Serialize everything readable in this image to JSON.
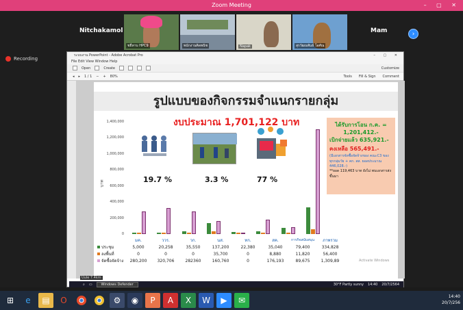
{
  "zoom": {
    "window_title": "Zoom Meeting",
    "recording_label": "Recording",
    "participants": [
      {
        "name": "Nitchakamol"
      },
      {
        "name": "Mam"
      }
    ],
    "tile_labels": [
      "ชยี่หาบ HPC9",
      "พนักงานคิดพนิช",
      "Napak",
      "สุรวัฒนพันธ์ โอศัณ"
    ]
  },
  "acrobat": {
    "title": "ระบบงาน PowerPoint - Adobe Acrobat Pro",
    "menu": "File  Edit  View  Window  Help",
    "toolbar_open": "Open",
    "toolbar_create": "Create",
    "customize": "Customize",
    "page_info": "1 / 1",
    "zoom": "80%",
    "tools": "Tools",
    "fill_sign": "Fill & Sign",
    "comment": "Comment"
  },
  "slide": {
    "title": "รูปแบบของกิจกรรมจำแนกรายกลุ่ม",
    "budget": "งบประมาณ  1,701,122  บาท",
    "y_axis_label": "บาท",
    "pct_1": "19.7 %",
    "pct_2": "3.3 %",
    "pct_3": "77 %",
    "info_line1": "ได้รับการโอน ก.ค. =",
    "info_line2": "1,201,412.-",
    "info_line3": "เบิกจ่ายแล้ว 635,921.-",
    "info_line4": "คงเหลือ 565,491.-",
    "info_line5": "(มีเอกสารจัดซื้อจัดจ้างของ คณะC3 ของทุกกลุ่มวัย + คก. สส. ยอดประมาณ 446,028.-)",
    "info_line6": "**ยอด 119,463 บาท ยังไม่ พบเอกสารส่งขึ้นมา"
  },
  "chart_data": {
    "type": "bar",
    "title": "รูปแบบของกิจกรรมจำแนกรายกลุ่ม",
    "ylabel": "บาท",
    "ylim": [
      0,
      1400000
    ],
    "yticks": [
      "1,400,000",
      "1,200,000",
      "1,000,000",
      "800,000",
      "600,000",
      "400,000",
      "200,000",
      "0"
    ],
    "categories": [
      "มค.",
      "ววร.",
      "วก.",
      "นส.",
      "ทก.",
      "สค.",
      "การกิจสนับสนุน",
      "ภาพรวม"
    ],
    "series": [
      {
        "name": "ประชุม",
        "color": "#3c8b3c",
        "values": [
          5000,
          20258,
          35550,
          137200,
          22380,
          35040,
          79400,
          334828
        ]
      },
      {
        "name": "ลงพื้นที่",
        "color": "#e07a20",
        "values": [
          0,
          0,
          0,
          35700,
          0,
          8880,
          11820,
          56400
        ]
      },
      {
        "name": "จัดซื้อจัดจ้าง",
        "color": "#d79fd2",
        "values": [
          280200,
          320706,
          282360,
          160760,
          0,
          176193,
          89675,
          1309894
        ]
      }
    ],
    "table_rows": [
      [
        "5,000",
        "20,258",
        "35,550",
        "137,200",
        "22,380",
        "35,040",
        "79,400",
        "334,828"
      ],
      [
        "0",
        "0",
        "0",
        "35,700",
        "0",
        "8,880",
        "11,820",
        "56,400"
      ],
      [
        "280,200",
        "320,706",
        "282360",
        "160,760",
        "0",
        "176,193",
        "89,675",
        "1,309,89"
      ]
    ]
  },
  "overlay": {
    "activate": "Activate Windows",
    "defender": "Windows Defender",
    "tooltip": "Uule 7.4km",
    "partly_sunny": "30°F  Partly sunny",
    "inner_time": "14:40",
    "inner_date": "20/7/2564"
  },
  "taskbar": {
    "time": "14:40",
    "date": "20/7/256"
  },
  "colors": {
    "zoom_title": "#e0407a",
    "budget_red": "#e82020",
    "info_bg": "#f8cbb0",
    "bar_purple": "#d79fd2"
  }
}
